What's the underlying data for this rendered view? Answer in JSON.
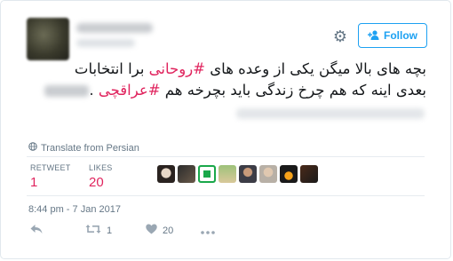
{
  "header": {
    "follow_label": "Follow",
    "gear_icon": "gear-icon",
    "follow_icon": "add-user-icon"
  },
  "tweet": {
    "line1_pre": "بچه های بالا میگن یکی از وعده های ",
    "hashtag1": "#روحانی",
    "line1_post": " برا انتخابات",
    "line2_pre": "بعدی اینه که هم چرخ زندگی باید بچرخه هم ",
    "hashtag2": "#عراقچی",
    "line2_post": " .",
    "hashtag_color": "#e0245e"
  },
  "translate": {
    "label": "Translate from Persian"
  },
  "stats": {
    "retweet_label": "RETWEET",
    "retweet_count": "1",
    "likes_label": "LIKES",
    "likes_count": "20",
    "value_color": "#e0245e"
  },
  "timestamp": "8:44 pm - 7 Jan 2017",
  "actions": {
    "retweet_count": "1",
    "like_count": "20"
  }
}
